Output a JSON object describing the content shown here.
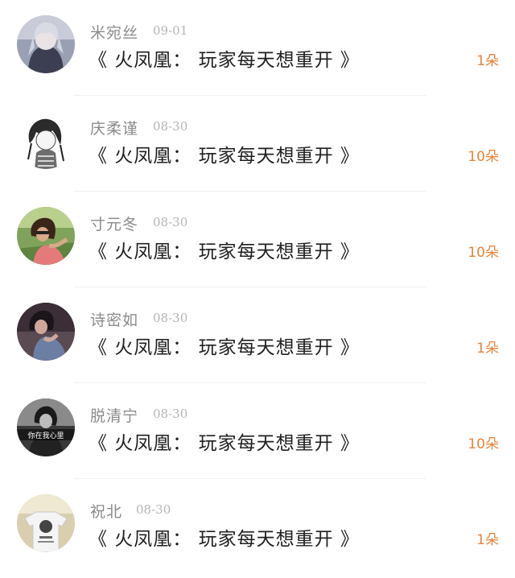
{
  "entries": [
    {
      "name": "米宛丝",
      "date": "09-01",
      "title": "《 火凤凰： 玩家每天想重开 》",
      "count": "1朵",
      "avatar_icon": "girl-anime-avatar"
    },
    {
      "name": "庆柔谨",
      "date": "08-30",
      "title": "《 火凤凰： 玩家每天想重开 》",
      "count": "10朵",
      "avatar_icon": "girl-sketch-avatar"
    },
    {
      "name": "寸元冬",
      "date": "08-30",
      "title": "《 火凤凰： 玩家每天想重开 》",
      "count": "10朵",
      "avatar_icon": "girl-outdoor-photo-avatar"
    },
    {
      "name": "诗密如",
      "date": "08-30",
      "title": "《 火凤凰： 玩家每天想重开 》",
      "count": "1朵",
      "avatar_icon": "girl-dark-photo-avatar"
    },
    {
      "name": "脱清宁",
      "date": "08-30",
      "title": "《 火凤凰： 玩家每天想重开 》",
      "count": "10朵",
      "avatar_icon": "grayscale-photo-avatar",
      "avatar_text": "你在我心里"
    },
    {
      "name": "祝北",
      "date": "08-30",
      "title": "《 火凤凰： 玩家每天想重开 》",
      "count": "1朵",
      "avatar_icon": "tshirt-photo-avatar"
    }
  ],
  "colors": {
    "name": "#8b8b8b",
    "date": "#b5b5b5",
    "title": "#1f1f1f",
    "count": "#e8823a"
  }
}
